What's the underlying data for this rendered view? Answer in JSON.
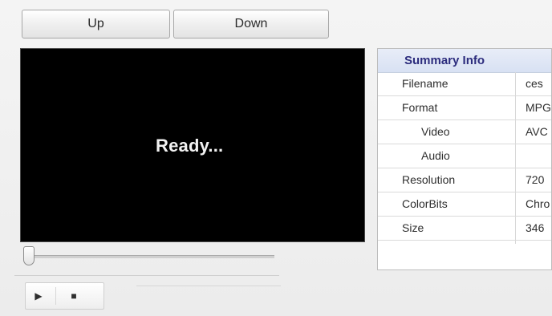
{
  "buttons": {
    "up": "Up",
    "down": "Down"
  },
  "player": {
    "status": "Ready..."
  },
  "summary": {
    "title": "Summary Info",
    "rows": [
      {
        "label": "Filename",
        "value": "ces"
      },
      {
        "label": "Format",
        "value": "MPG"
      },
      {
        "label": "Video",
        "value": "AVC"
      },
      {
        "label": "Audio",
        "value": ""
      },
      {
        "label": "Resolution",
        "value": "720"
      },
      {
        "label": "ColorBits",
        "value": "Chro"
      },
      {
        "label": "Size",
        "value": "346"
      }
    ]
  },
  "controls": {
    "play_icon": "▶",
    "stop_icon": "■"
  }
}
